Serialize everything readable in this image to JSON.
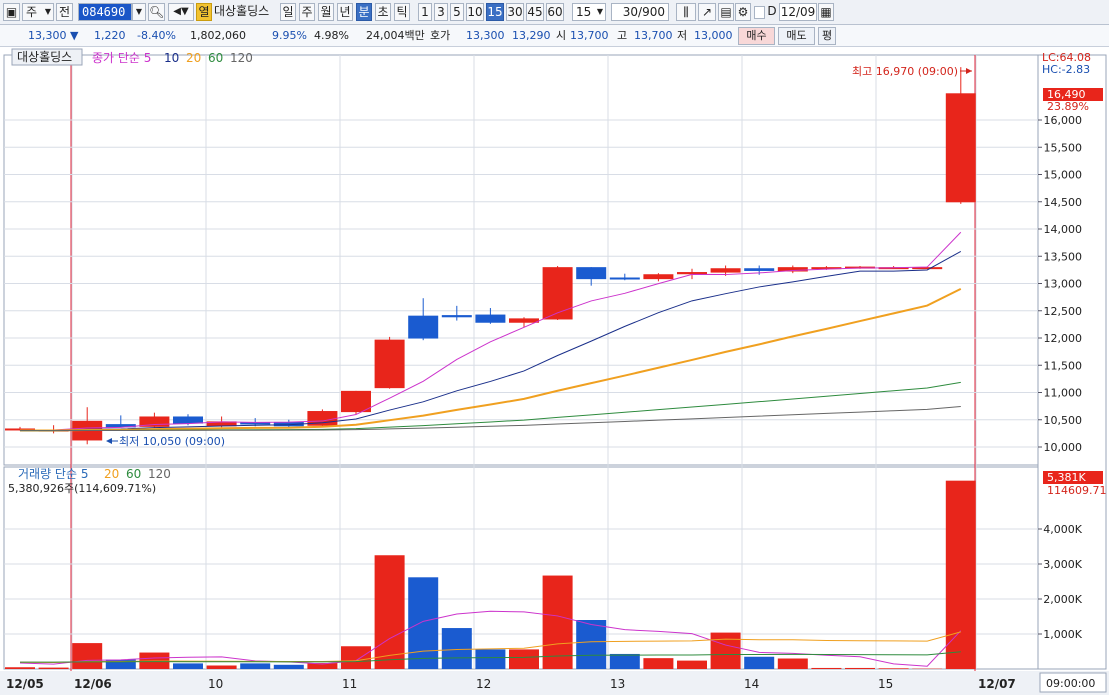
{
  "toolbar": {
    "market_select": "주",
    "prev_btn": "전",
    "stock_code": "084690",
    "stock_name": "대상홀딩스",
    "period_buttons": [
      "일",
      "주",
      "월",
      "년",
      "분",
      "초",
      "틱"
    ],
    "selected_period": "분",
    "interval_buttons": [
      "1",
      "3",
      "5",
      "10",
      "15",
      "30",
      "45",
      "60"
    ],
    "selected_interval": "15",
    "interval_value": "15",
    "count_value": "30/900",
    "date_value": "12/09",
    "d_label": "D",
    "open_label": "열"
  },
  "info": {
    "price": "13,300",
    "change": "1,220",
    "change_pct": "-8.40%",
    "volume": "1,802,060",
    "v1": "9.95%",
    "v2": "4.98%",
    "amount": "24,004백만",
    "quote_label": "호가",
    "quote1": "13,300",
    "quote2": "13,290",
    "open_label": "시",
    "open": "13,700",
    "high_label": "고",
    "high": "13,700",
    "low_label": "저",
    "low": "13,000",
    "buy_btn": "매수",
    "sell_btn": "매도",
    "eval_btn": "평"
  },
  "chart_data": {
    "type": "candlestick",
    "legend_name": "대상홀딩스",
    "price_legend": [
      "종가 단순 5",
      "10",
      "20",
      "60",
      "120"
    ],
    "volume_legend": [
      "거래량 단순 5",
      "20",
      "60",
      "120"
    ],
    "volume_sub": "5,380,926주(114,609.71%)",
    "lc_label": "LC:64.08",
    "hc_label": "HC:-2.83",
    "current_price_label": "16,490",
    "current_pct_label": "23.89%",
    "current_volume_label": "5,381K",
    "current_volume_pct_label": "114609.71",
    "high_annotation": "최고 16,970 (09:00)",
    "low_annotation": "최저 10,050 (09:00)",
    "price_ticks": [
      "16,000",
      "15,500",
      "15,000",
      "14,500",
      "14,000",
      "13,500",
      "13,000",
      "12,500",
      "12,000",
      "11,500",
      "11,000",
      "10,500",
      "10,000"
    ],
    "volume_ticks": [
      "4,000K",
      "3,000K",
      "2,000K",
      "1,000K"
    ],
    "x_labels": [
      "12/05",
      "12/06",
      "10",
      "11",
      "12",
      "13",
      "14",
      "15",
      "12/07"
    ],
    "time_label": "09:00:00",
    "candles": [
      {
        "o": 10330,
        "h": 10370,
        "l": 10300,
        "c": 10340,
        "v": 50
      },
      {
        "o": 10300,
        "h": 10400,
        "l": 10250,
        "c": 10320,
        "v": 40
      },
      {
        "o": 10120,
        "h": 10730,
        "l": 10050,
        "c": 10480,
        "v": 740
      },
      {
        "o": 10420,
        "h": 10580,
        "l": 10380,
        "c": 10360,
        "v": 270
      },
      {
        "o": 10370,
        "h": 10630,
        "l": 10360,
        "c": 10560,
        "v": 470
      },
      {
        "o": 10560,
        "h": 10600,
        "l": 10400,
        "c": 10430,
        "v": 160
      },
      {
        "o": 10380,
        "h": 10560,
        "l": 10360,
        "c": 10470,
        "v": 100
      },
      {
        "o": 10450,
        "h": 10530,
        "l": 10380,
        "c": 10440,
        "v": 160
      },
      {
        "o": 10460,
        "h": 10500,
        "l": 10360,
        "c": 10380,
        "v": 120
      },
      {
        "o": 10390,
        "h": 10690,
        "l": 10380,
        "c": 10660,
        "v": 170
      },
      {
        "o": 10640,
        "h": 11030,
        "l": 10600,
        "c": 11030,
        "v": 650
      },
      {
        "o": 11080,
        "h": 12020,
        "l": 11070,
        "c": 11970,
        "v": 3250
      },
      {
        "o": 12410,
        "h": 12730,
        "l": 11960,
        "c": 11990,
        "v": 2620
      },
      {
        "o": 12420,
        "h": 12590,
        "l": 12320,
        "c": 12380,
        "v": 1170
      },
      {
        "o": 12430,
        "h": 12550,
        "l": 12260,
        "c": 12280,
        "v": 560
      },
      {
        "o": 12280,
        "h": 12380,
        "l": 12200,
        "c": 12360,
        "v": 560
      },
      {
        "o": 12340,
        "h": 13320,
        "l": 12330,
        "c": 13300,
        "v": 2670
      },
      {
        "o": 13300,
        "h": 13300,
        "l": 12960,
        "c": 13080,
        "v": 1400
      },
      {
        "o": 13110,
        "h": 13180,
        "l": 13060,
        "c": 13080,
        "v": 430
      },
      {
        "o": 13080,
        "h": 13190,
        "l": 13040,
        "c": 13170,
        "v": 310
      },
      {
        "o": 13170,
        "h": 13270,
        "l": 13080,
        "c": 13210,
        "v": 240
      },
      {
        "o": 13200,
        "h": 13330,
        "l": 13140,
        "c": 13280,
        "v": 1040
      },
      {
        "o": 13280,
        "h": 13330,
        "l": 13160,
        "c": 13230,
        "v": 350
      },
      {
        "o": 13220,
        "h": 13330,
        "l": 13190,
        "c": 13300,
        "v": 300
      },
      {
        "o": 13290,
        "h": 13320,
        "l": 13250,
        "c": 13300,
        "v": 30
      },
      {
        "o": 13290,
        "h": 13320,
        "l": 13270,
        "c": 13310,
        "v": 30
      },
      {
        "o": 13300,
        "h": 13320,
        "l": 13270,
        "c": 13300,
        "v": 20
      },
      {
        "o": 13300,
        "h": 13310,
        "l": 13270,
        "c": 13300,
        "v": 10
      },
      {
        "o": 14490,
        "h": 16970,
        "l": 14460,
        "c": 16490,
        "v": 5381
      }
    ],
    "colors": {
      "up": "#e8251b",
      "down": "#1a5bd0",
      "ma5": "#cc33cc",
      "ma10": "#1a2f8a",
      "ma20": "#f0a020",
      "ma60": "#2e8b3e",
      "ma120": "#666666",
      "grid": "#d8dde6",
      "accent_line": "#e0243a"
    }
  }
}
